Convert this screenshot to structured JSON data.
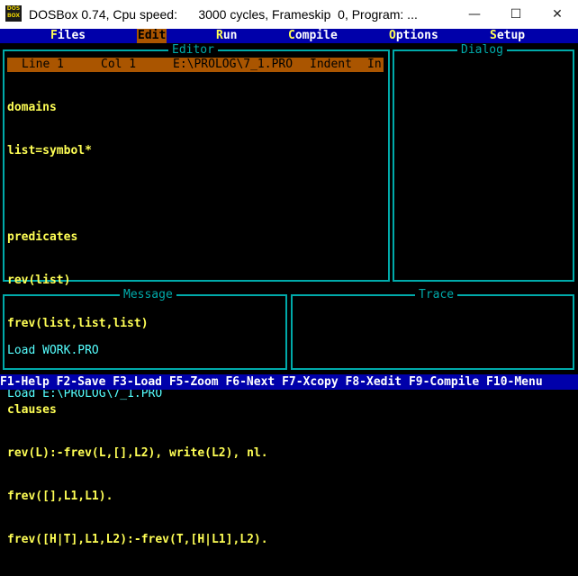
{
  "window": {
    "title": "DOSBox 0.74, Cpu speed:      3000 cycles, Frameskip  0, Program: ...",
    "icon_text": "DOS BOX",
    "controls": {
      "minimize": "—",
      "maximize": "☐",
      "close": "✕"
    }
  },
  "menu": {
    "items": [
      {
        "hot": "F",
        "rest": "iles"
      },
      {
        "hot": "E",
        "rest": "dit"
      },
      {
        "hot": "R",
        "rest": "un"
      },
      {
        "hot": "C",
        "rest": "ompile"
      },
      {
        "hot": "O",
        "rest": "ptions"
      },
      {
        "hot": "S",
        "rest": "etup"
      }
    ]
  },
  "editor": {
    "title": "Editor",
    "status": {
      "line": "Line 1",
      "col": "Col 1",
      "file": "E:\\PROLOG\\7_1.PRO",
      "indent": "Indent",
      "insert": "In"
    },
    "lines": [
      "domains",
      "list=symbol*",
      "",
      "predicates",
      "rev(list)",
      "frev(list,list,list)",
      "",
      "clauses",
      "rev(L):-frev(L,[],L2), write(L2), nl.",
      "frev([],L1,L1).",
      "frev([H|T],L1,L2):-frev(T,[H|L1],L2)."
    ]
  },
  "dialog": {
    "title": "Dialog"
  },
  "message": {
    "title": "Message",
    "lines": [
      "Load WORK.PRO",
      "Load E:\\PROLOG\\7_1.PRO"
    ]
  },
  "trace": {
    "title": "Trace"
  },
  "fkeys": "F1-Help F2-Save F3-Load F5-Zoom F6-Next F7-Xcopy F8-Xedit F9-Compile F10-Menu",
  "colors": {
    "menu_bg": "#0000aa",
    "border": "#00aaaa",
    "status_bg": "#aa5500",
    "code_text": "#ffff55",
    "message_text": "#55ffff"
  }
}
